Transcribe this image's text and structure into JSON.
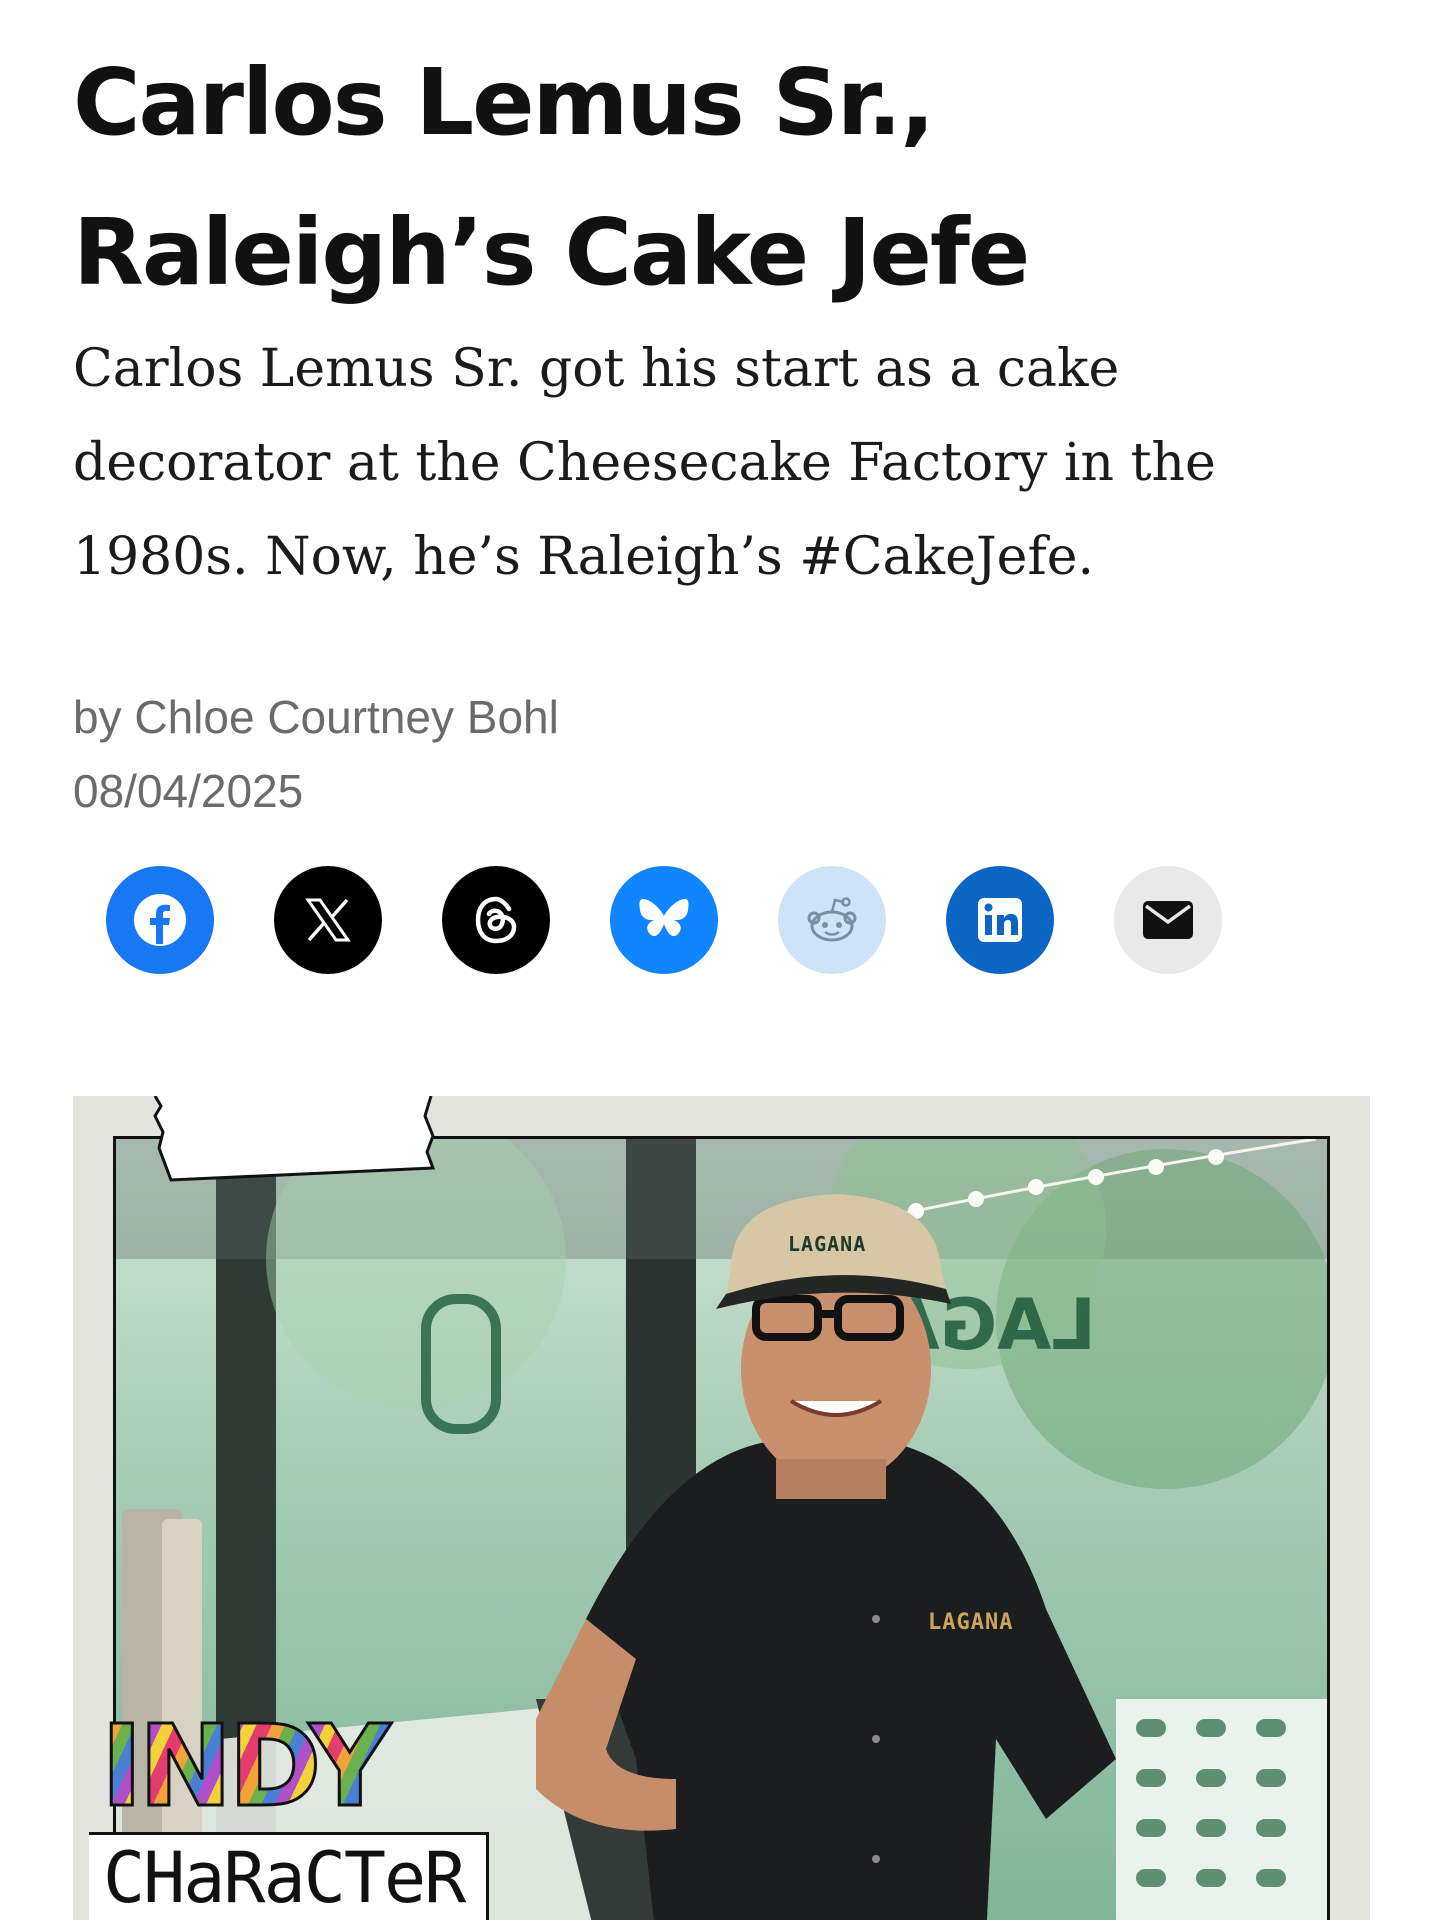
{
  "article": {
    "headline_line1": "Carlos Lemus Sr.,",
    "headline_line2": "Raleigh’s Cake Jefe",
    "dek": "Carlos Lemus Sr. got his start as a cake decorator at the Cheesecake Factory in the 1980s. Now, he’s Raleigh’s #CakeJefe.",
    "byline": "by Chloe Courtney Bohl",
    "date": "08/04/2025"
  },
  "share": {
    "buttons": [
      {
        "name": "facebook",
        "icon": "facebook-icon",
        "color": "#1877F2"
      },
      {
        "name": "x",
        "icon": "x-icon",
        "color": "#000000"
      },
      {
        "name": "threads",
        "icon": "threads-icon",
        "color": "#000000"
      },
      {
        "name": "bluesky",
        "icon": "bluesky-icon",
        "color": "#1185FE"
      },
      {
        "name": "reddit",
        "icon": "reddit-icon",
        "color": "#CEE3F8"
      },
      {
        "name": "linkedin",
        "icon": "linkedin-icon",
        "color": "#0A66C2"
      },
      {
        "name": "email",
        "icon": "email-icon",
        "color": "#E9E9E9"
      }
    ]
  },
  "hero": {
    "badge_line1": "INDY",
    "badge_line2": "CHaRaCTeR",
    "cap_logo": "LAGANA",
    "shirt_logo": "LAGANA",
    "window_sign": "LAGAL"
  }
}
